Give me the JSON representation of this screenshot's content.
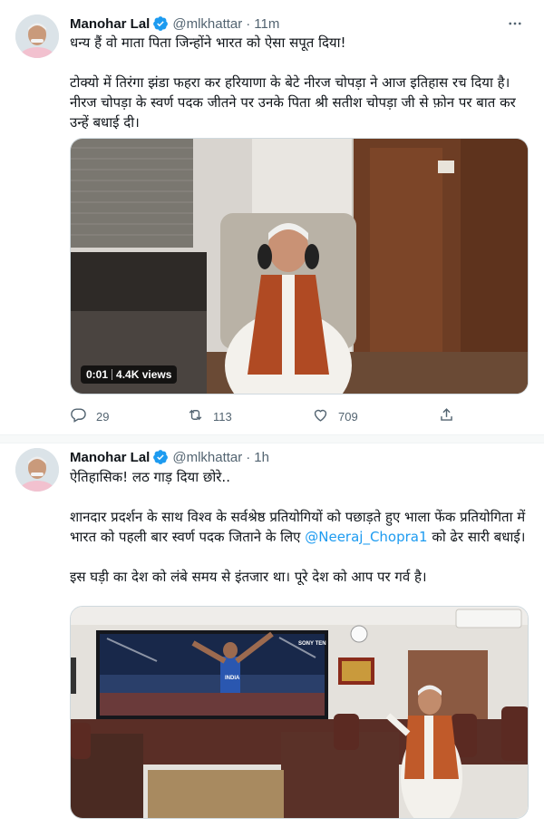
{
  "tweets": [
    {
      "author_name": "Manohar Lal",
      "handle": "@mlkhattar",
      "separator": "·",
      "time": "11m",
      "paragraphs": [
        "धन्य हैं वो माता पिता जिन्होंने भारत को ऐसा सपूत दिया!",
        "टोक्यो में तिरंगा झंडा फहरा कर हरियाणा के बेटे नीरज चोपड़ा ने आज इतिहास रच दिया है। नीरज चोपड़ा के स्वर्ण पदक जीतने पर उनके पिता श्री सतीश चोपड़ा जी से फ़ोन पर बात कर उन्हें बधाई दी।"
      ],
      "video": {
        "time": "0:01",
        "views": "4.4K views"
      },
      "replies": "29",
      "retweets": "113",
      "likes": "709"
    },
    {
      "author_name": "Manohar Lal",
      "handle": "@mlkhattar",
      "separator": "·",
      "time": "1h",
      "paragraphs": [
        "ऐतिहासिक! लठ गाड़ दिया छोरे..",
        "शानदार प्रदर्शन के साथ विश्व के सर्वश्रेष्ठ प्रतियोगियों को पछाड़ते हुए भाला फेंक प्रतियोगिता में भारत को पहली बार स्वर्ण पदक जिताने के लिए",
        "@Neeraj_Chopra1",
        "को ढेर सारी बधाई।",
        "इस घड़ी का देश को लंबे समय से इंतजार था। पूरे देश को आप पर गर्व है।"
      ],
      "tv_brand": "SONY TEN",
      "tv_jersey": "INDIA"
    }
  ],
  "colors": {
    "accent": "#1d9bf0",
    "secondary_text": "#536471",
    "text": "#0f1419"
  }
}
